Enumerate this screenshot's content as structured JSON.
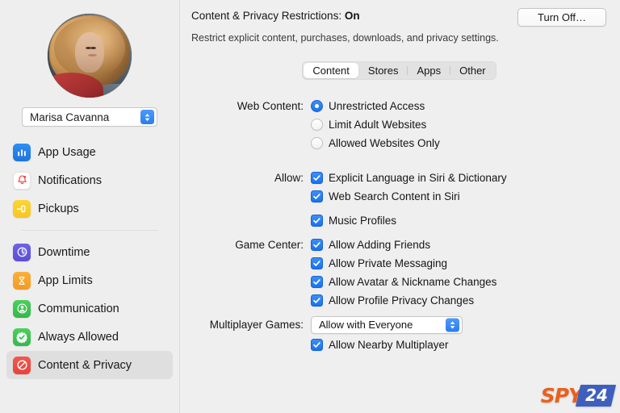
{
  "sidebar": {
    "user_name": "Marisa Cavanna",
    "avatar_alt": "user-profile-photo",
    "items": [
      {
        "label": "App Usage",
        "icon": "bar-chart-icon",
        "icon_class": "ic-appusage",
        "selected": false
      },
      {
        "label": "Notifications",
        "icon": "bell-icon",
        "icon_class": "ic-notifications",
        "selected": false
      },
      {
        "label": "Pickups",
        "icon": "pickup-hand-icon",
        "icon_class": "ic-pickups",
        "selected": false
      },
      {
        "label": "Downtime",
        "icon": "clock-icon",
        "icon_class": "ic-downtime",
        "selected": false
      },
      {
        "label": "App Limits",
        "icon": "hourglass-icon",
        "icon_class": "ic-applimits",
        "selected": false
      },
      {
        "label": "Communication",
        "icon": "person-icon",
        "icon_class": "ic-communication",
        "selected": false
      },
      {
        "label": "Always Allowed",
        "icon": "checkmark-icon",
        "icon_class": "ic-alwaysallowed",
        "selected": false
      },
      {
        "label": "Content & Privacy",
        "icon": "no-entry-icon",
        "icon_class": "ic-contentprivacy",
        "selected": true
      }
    ]
  },
  "header": {
    "title_prefix": "Content & Privacy Restrictions:",
    "status": "On",
    "turn_off_label": "Turn Off…",
    "subtitle": "Restrict explicit content, purchases, downloads, and privacy settings."
  },
  "tabs": [
    {
      "label": "Content",
      "active": true
    },
    {
      "label": "Stores",
      "active": false
    },
    {
      "label": "Apps",
      "active": false
    },
    {
      "label": "Other",
      "active": false
    }
  ],
  "sections": {
    "web_content": {
      "label": "Web Content:",
      "options": [
        {
          "label": "Unrestricted Access",
          "selected": true
        },
        {
          "label": "Limit Adult Websites",
          "selected": false
        },
        {
          "label": "Allowed Websites Only",
          "selected": false
        }
      ]
    },
    "allow": {
      "label": "Allow:",
      "items": [
        {
          "label": "Explicit Language in Siri & Dictionary",
          "checked": true
        },
        {
          "label": "Web Search Content in Siri",
          "checked": true
        }
      ],
      "extra": [
        {
          "label": "Music Profiles",
          "checked": true
        }
      ]
    },
    "game_center": {
      "label": "Game Center:",
      "items": [
        {
          "label": "Allow Adding Friends",
          "checked": true
        },
        {
          "label": "Allow Private Messaging",
          "checked": true
        },
        {
          "label": "Allow Avatar & Nickname Changes",
          "checked": true
        },
        {
          "label": "Allow Profile Privacy Changes",
          "checked": true
        }
      ]
    },
    "multiplayer": {
      "label": "Multiplayer Games:",
      "selected_value": "Allow with Everyone",
      "nearby": {
        "label": "Allow Nearby Multiplayer",
        "checked": true
      }
    }
  },
  "watermark": {
    "text_primary": "SPY",
    "text_secondary": "24",
    "color_primary": "#E8611C",
    "color_secondary": "#3F5FBE"
  },
  "colors": {
    "accent_blue": "#2B7CF0",
    "window_bg": "#EFEFEF",
    "sidebar_bg": "#EEEEEE",
    "selected_row": "#DEDEDE"
  }
}
